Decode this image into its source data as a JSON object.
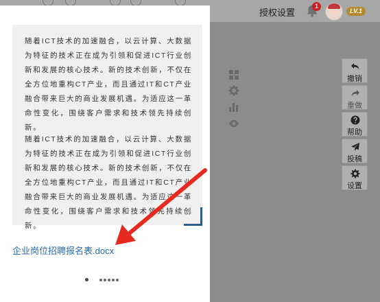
{
  "header": {
    "auth_settings": "授权设置",
    "notification_count": "1",
    "level_badge": "LV.1"
  },
  "preview": {
    "paragraphs": [
      "随着ICT技术的加速融合，以云计算、大数据为特征的技术正在成为引领和促进ICT行业创新和发展的核心技术。新的技术创新，不仅在全方位地重构CT产业，而且通过IT和CT产业融合带来巨大的商业发展机遇。为适应这一革命性变化，围绕客户需求和技术领先持续创新。",
      "随着ICT技术的加速融合，以云计算、大数据为特征的技术正在成为引领和促进ICT行业创新和发展的核心技术。新的技术创新，不仅在全方位地重构CT产业，而且通过IT和CT产业融合带来巨大的商业发展机遇。为适应这一革命性变化，围绕客户需求和技术领先持续创新。"
    ]
  },
  "attachment": {
    "filename": "企业岗位招聘报名表.docx"
  },
  "toolbar": {
    "undo": "撤销",
    "redo": "重做",
    "help": "帮助",
    "submit": "投稿",
    "settings": "设置"
  },
  "colors": {
    "link": "#2a6cb3",
    "arrow": "#e8291f",
    "corner_accent": "#2c5d8c",
    "badge": "#cc1f1f"
  }
}
